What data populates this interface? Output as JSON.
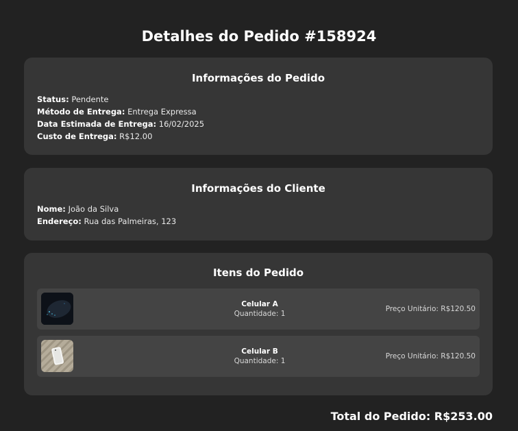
{
  "page": {
    "title": "Detalhes do Pedido #158924"
  },
  "order_info": {
    "title": "Informações do Pedido",
    "status_label": "Status:",
    "status_value": "Pendente",
    "delivery_method_label": "Método de Entrega:",
    "delivery_method_value": "Entrega Expressa",
    "estimated_date_label": "Data Estimada de Entrega:",
    "estimated_date_value": "16/02/2025",
    "delivery_cost_label": "Custo de Entrega:",
    "delivery_cost_value": "R$12.00"
  },
  "customer_info": {
    "title": "Informações do Cliente",
    "name_label": "Nome:",
    "name_value": "João da Silva",
    "address_label": "Endereço:",
    "address_value": "Rua das Palmeiras, 123"
  },
  "items": {
    "title": "Itens do Pedido",
    "list": [
      {
        "name": "Celular A",
        "quantity": "Quantidade: 1",
        "unit_price": "Preço Unitário: R$120.50"
      },
      {
        "name": "Celular B",
        "quantity": "Quantidade: 1",
        "unit_price": "Preço Unitário: R$120.50"
      }
    ]
  },
  "total": {
    "text": "Total do Pedido: R$253.00"
  },
  "colors": {
    "background": "#222222",
    "card": "#363636",
    "item_row": "#444444",
    "text": "#ffffff"
  }
}
